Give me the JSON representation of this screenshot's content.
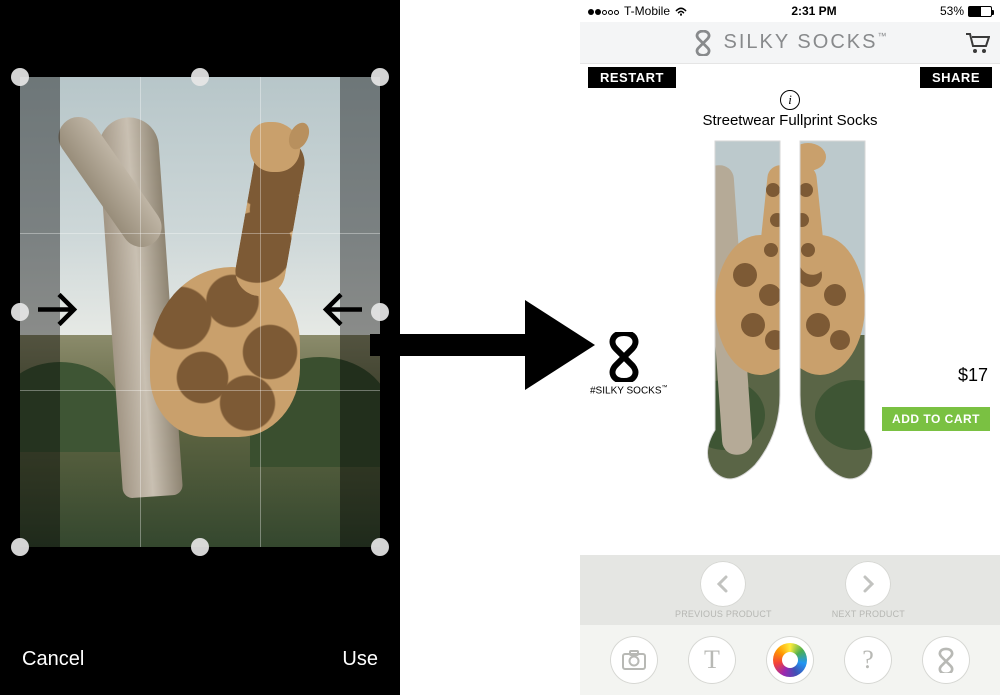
{
  "crop_editor": {
    "cancel_label": "Cancel",
    "use_label": "Use"
  },
  "status": {
    "carrier": "T-Mobile",
    "time": "2:31 PM",
    "battery_pct": "53%"
  },
  "brand": {
    "name": "SILKY SOCKS",
    "hashtag": "#SILKY SOCKS"
  },
  "app": {
    "restart_label": "RESTART",
    "share_label": "SHARE",
    "product_title": "Streetwear Fullprint Socks",
    "price": "$17",
    "add_to_cart_label": "ADD TO CART",
    "prev_label": "PREVIOUS PRODUCT",
    "next_label": "NEXT PRODUCT"
  },
  "colors": {
    "accent_green": "#7ac142",
    "brand_grey": "#888a8c"
  }
}
